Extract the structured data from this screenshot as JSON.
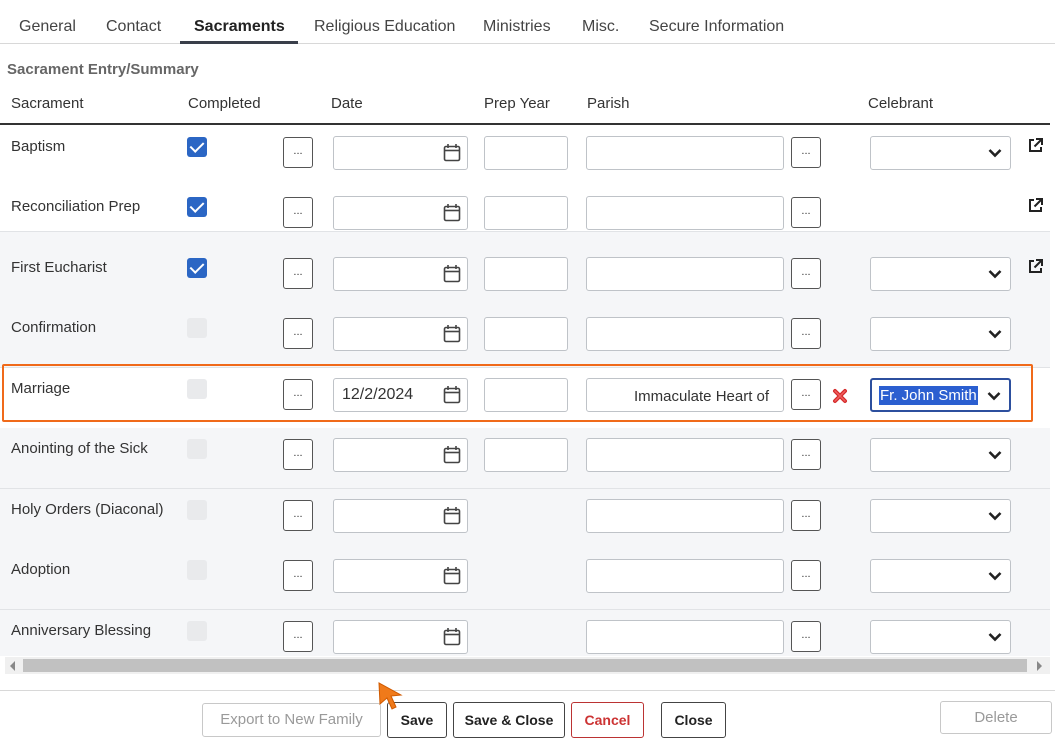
{
  "tabs": {
    "items": [
      "General",
      "Contact",
      "Sacraments",
      "Religious Education",
      "Ministries",
      "Misc.",
      "Secure Information"
    ],
    "active": "Sacraments"
  },
  "section_title": "Sacrament Entry/Summary",
  "headers": {
    "sacrament": "Sacrament",
    "completed": "Completed",
    "date": "Date",
    "prep_year": "Prep Year",
    "parish": "Parish",
    "celebrant": "Celebrant"
  },
  "rows": [
    {
      "name": "Baptism",
      "completed": true,
      "date": "",
      "prep_year": "",
      "parish": "",
      "celebrant": ""
    },
    {
      "name": "Reconciliation Prep",
      "completed": true,
      "date": "",
      "prep_year": "",
      "parish": "",
      "celebrant": ""
    },
    {
      "name": "First Eucharist",
      "completed": true,
      "date": "",
      "prep_year": "",
      "parish": "",
      "celebrant": ""
    },
    {
      "name": "Confirmation",
      "completed": false,
      "date": "",
      "prep_year": "",
      "parish": "",
      "celebrant": ""
    },
    {
      "name": "Marriage",
      "completed": false,
      "date": "12/2/2024",
      "prep_year": "",
      "parish": "Immaculate Heart of",
      "celebrant": "Fr. John Smith"
    },
    {
      "name": "Anointing of the Sick",
      "completed": false,
      "date": "",
      "prep_year": "",
      "parish": "",
      "celebrant": ""
    },
    {
      "name": "Holy Orders (Diaconal)",
      "completed": false,
      "date": "",
      "parish": "",
      "celebrant": ""
    },
    {
      "name": "Adoption",
      "completed": false,
      "date": "",
      "parish": "",
      "celebrant": ""
    },
    {
      "name": "Anniversary Blessing",
      "completed": false,
      "date": "",
      "parish": "",
      "celebrant": ""
    }
  ],
  "lookup_label": "...",
  "footer": {
    "export": "Export to New Family",
    "save": "Save",
    "save_close": "Save & Close",
    "cancel": "Cancel",
    "close": "Close",
    "delete": "Delete"
  },
  "colors": {
    "accent": "#2b66c4",
    "highlight": "#f06a1a",
    "cancel": "#cc3333"
  }
}
